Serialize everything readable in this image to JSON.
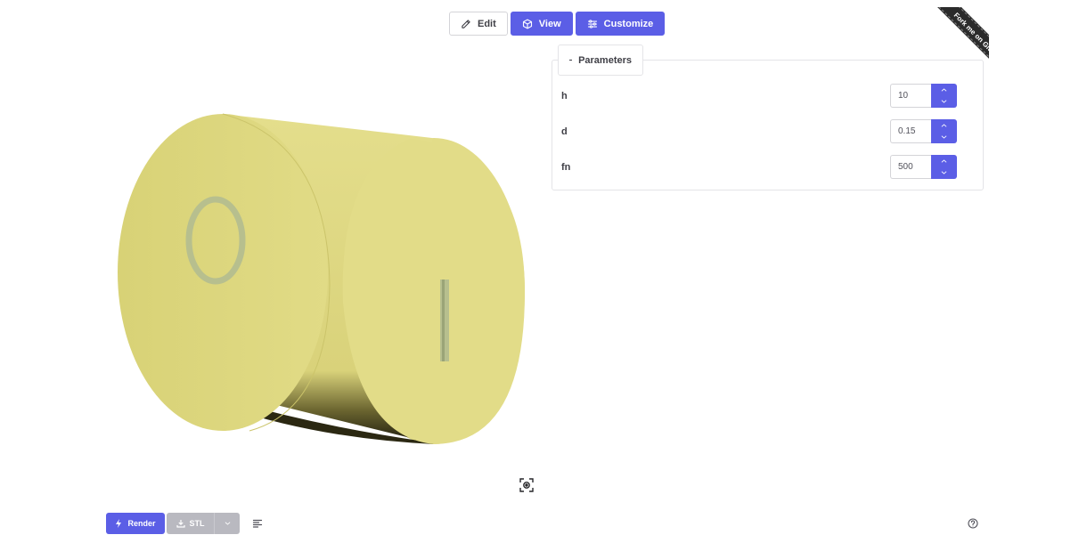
{
  "toolbar": {
    "edit_label": "Edit",
    "view_label": "View",
    "customize_label": "Customize"
  },
  "ribbon": {
    "text": "Fork me on GitHub"
  },
  "parameters": {
    "legend": "Parameters",
    "items": [
      {
        "name": "h",
        "value": "10"
      },
      {
        "name": "d",
        "value": "0.15"
      },
      {
        "name": "fn",
        "value": "500"
      }
    ]
  },
  "viewer": {
    "model_color": "#e1db86",
    "icon": "camera-reset-icon"
  },
  "bottom": {
    "render_label": "Render",
    "export_label": "STL",
    "log_icon": "text-lines-icon",
    "help_icon": "help-circle-icon"
  },
  "colors": {
    "accent": "#5b5ee6",
    "disabled": "#b9b9c0"
  }
}
